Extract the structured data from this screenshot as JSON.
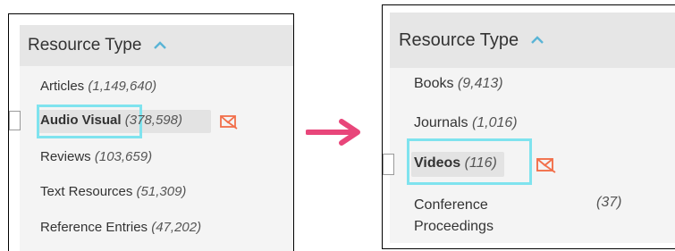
{
  "colors": {
    "header_bg": "#e6e6e6",
    "panel_bg": "#f4f4f4",
    "accent": "#5ab4d6",
    "highlight": "#7fe3ee",
    "arrow": "#e8467a",
    "mail_icon": "#f26f4a"
  },
  "left_panel": {
    "header": {
      "title": "Resource Type",
      "icon": "chevron-up-icon"
    },
    "items": [
      {
        "label": "Articles",
        "count": "(1,149,640)"
      },
      {
        "label": "Audio Visual",
        "count": "(378,598)",
        "selected": true
      },
      {
        "label": "Reviews",
        "count": "(103,659)"
      },
      {
        "label": "Text Resources",
        "count": "(51,309)"
      },
      {
        "label": "Reference Entries",
        "count": "(47,202)"
      }
    ]
  },
  "right_panel": {
    "header": {
      "title": "Resource Type",
      "icon": "chevron-up-icon"
    },
    "items": [
      {
        "label": "Books",
        "count": "(9,413)"
      },
      {
        "label": "Journals",
        "count": "(1,016)"
      },
      {
        "label": "Videos",
        "count": "(116)",
        "selected": true
      },
      {
        "label_line1": "Conference",
        "label_line2": "Proceedings",
        "count": "(37)"
      }
    ]
  },
  "icons": {
    "arrow": "right-arrow-icon",
    "remove": "mail-remove-icon"
  }
}
